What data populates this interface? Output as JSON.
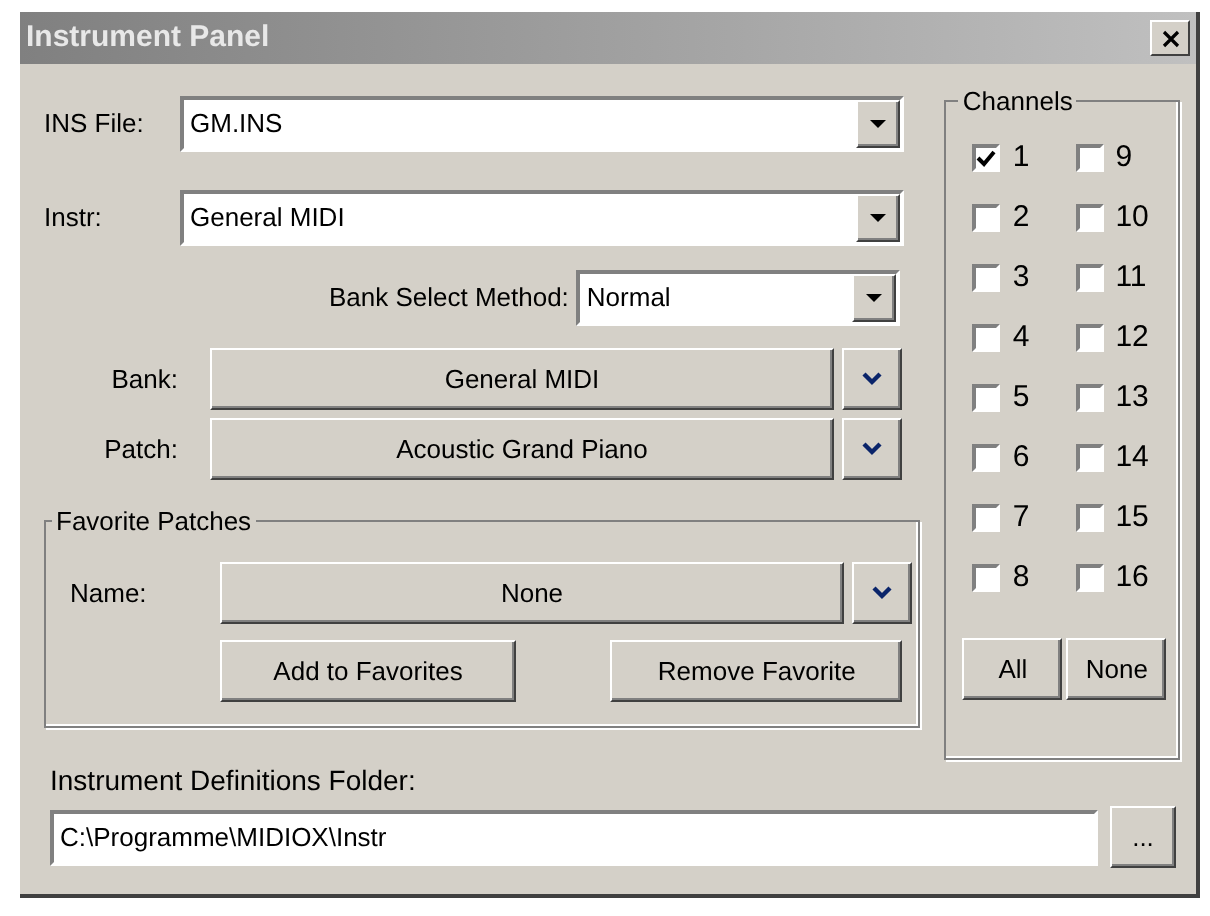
{
  "window": {
    "title": "Instrument Panel"
  },
  "ins_file": {
    "label": "INS File:",
    "value": "GM.INS"
  },
  "instr": {
    "label": "Instr:",
    "value": "General MIDI"
  },
  "bank_select_method": {
    "label": "Bank Select Method:",
    "value": "Normal"
  },
  "bank": {
    "label": "Bank:",
    "value": "General MIDI"
  },
  "patch": {
    "label": "Patch:",
    "value": "Acoustic Grand Piano"
  },
  "favorite_patches": {
    "title": "Favorite Patches",
    "name_label": "Name:",
    "name_value": "None",
    "buttons": [
      "Add to Favorites",
      "Remove Favorite"
    ]
  },
  "channels": {
    "title": "Channels",
    "items": [
      {
        "label": "1",
        "checked": true
      },
      {
        "label": "2",
        "checked": false
      },
      {
        "label": "3",
        "checked": false
      },
      {
        "label": "4",
        "checked": false
      },
      {
        "label": "5",
        "checked": false
      },
      {
        "label": "6",
        "checked": false
      },
      {
        "label": "7",
        "checked": false
      },
      {
        "label": "8",
        "checked": false
      },
      {
        "label": "9",
        "checked": false
      },
      {
        "label": "10",
        "checked": false
      },
      {
        "label": "11",
        "checked": false
      },
      {
        "label": "12",
        "checked": false
      },
      {
        "label": "13",
        "checked": false
      },
      {
        "label": "14",
        "checked": false
      },
      {
        "label": "15",
        "checked": false
      },
      {
        "label": "16",
        "checked": false
      }
    ],
    "buttons": [
      "All",
      "None"
    ]
  },
  "folder": {
    "label": "Instrument Definitions Folder:",
    "value": "C:\\Programme\\MIDIOX\\Instr",
    "browse": "..."
  }
}
